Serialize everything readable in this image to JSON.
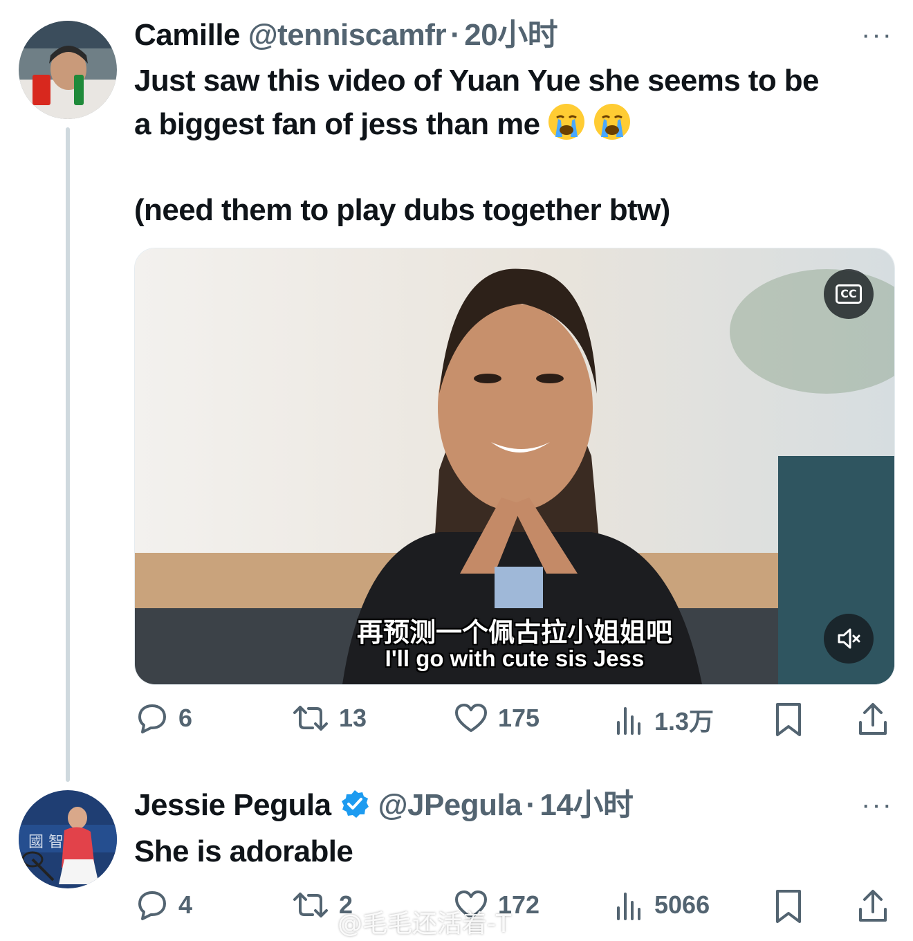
{
  "tweet1": {
    "name": "Camille",
    "handle": "@tenniscamfr",
    "separator": "·",
    "time": "20小时",
    "more": "···",
    "text_line1": "Just saw this video of Yuan Yue she seems to be",
    "text_line2": "a biggest fan of jess than me",
    "text_emojis": [
      "loudly-crying-face",
      "loudly-crying-face"
    ],
    "text_line3": "(need them to play dubs together btw)",
    "media": {
      "cc_label": "CC",
      "subtitle_zh": "再预测一个佩古拉小姐姐吧",
      "subtitle_en": "I'll go with cute sis Jess",
      "mute_icon": "speaker-muted-icon"
    },
    "actions": {
      "replies": "6",
      "reposts": "13",
      "likes": "175",
      "views": "1.3万"
    }
  },
  "tweet2": {
    "name": "Jessie Pegula",
    "verified": true,
    "handle": "@JPegula",
    "separator": "·",
    "time": "14小时",
    "more": "···",
    "text": "She is adorable",
    "actions": {
      "replies": "4",
      "reposts": "2",
      "likes": "172",
      "views": "5066"
    }
  },
  "watermark": "@毛毛还活着-T",
  "colors": {
    "text": "#0f1419",
    "secondary": "#536471",
    "verified": "#1d9bf0",
    "thread_line": "#cfd9de"
  }
}
